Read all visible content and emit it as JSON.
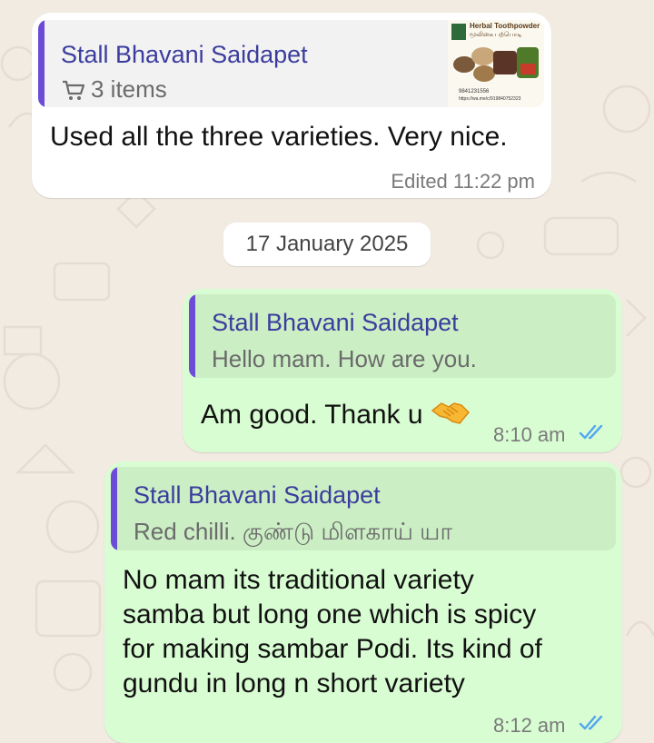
{
  "messages": [
    {
      "quote_name": "Stall Bhavani Saidapet",
      "quote_items": "3 items",
      "thumb": {
        "title": "Herbal Toothpowder",
        "subtitle": "மூலிகை பற்பொடி",
        "phone": "9841231556",
        "url": "https://wa.me/c/919840752323"
      },
      "text": "Used all the three varieties. Very nice.",
      "meta": "Edited 11:22 pm"
    },
    {
      "quote_name": "Stall Bhavani Saidapet",
      "quote_text": "Hello mam. How are you.",
      "text": "Am good. Thank u",
      "emoji": "handshake-emoji",
      "time": "8:10 am",
      "status": "read-double-check"
    },
    {
      "quote_name": "Stall Bhavani Saidapet",
      "quote_text": "Red chilli. குண்டு மிளகாய் யா",
      "text_lines": [
        "No mam its traditional variety",
        "samba but long one which is spicy",
        "for making sambar Podi. Its kind of",
        "gundu in long n short variety"
      ],
      "time": "8:12 am",
      "status": "read-double-check"
    }
  ],
  "date_separator": "17 January 2025",
  "colors": {
    "background": "#f1ebe2",
    "incoming": "#ffffff",
    "outgoing": "#d9fdd3",
    "quote_bar": "#6c4bd6",
    "read_tick": "#53a6f0"
  }
}
